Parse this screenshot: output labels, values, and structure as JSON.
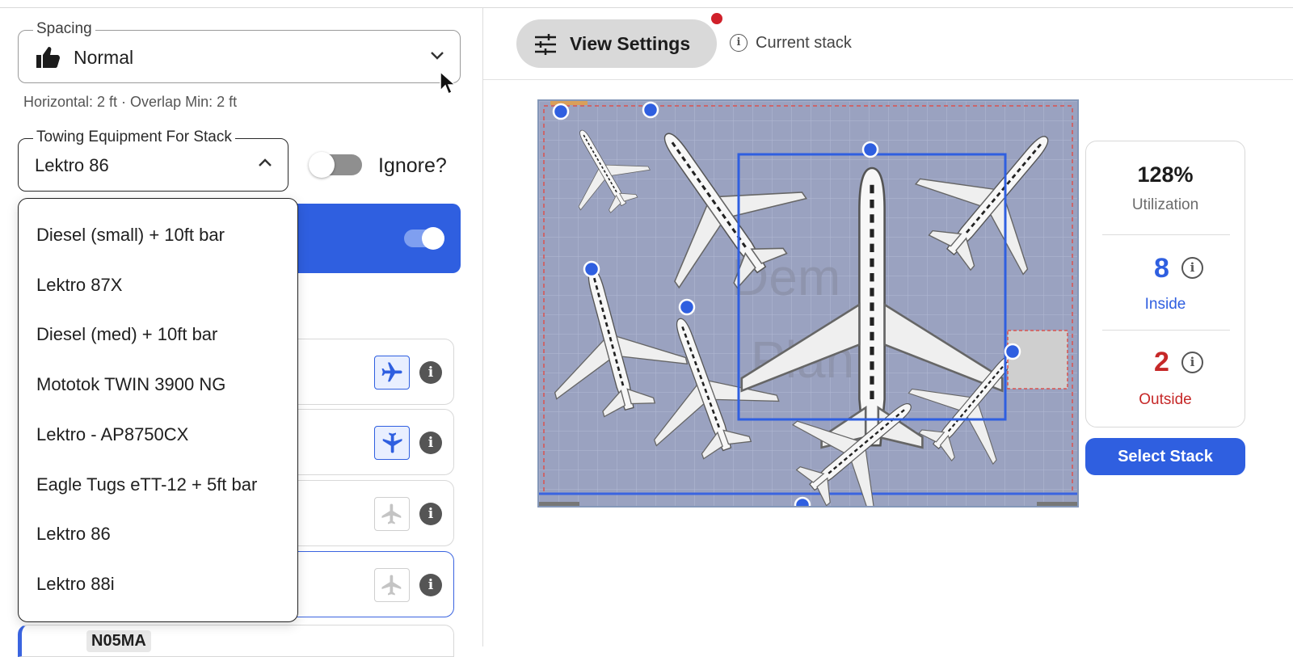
{
  "spacing": {
    "legend": "Spacing",
    "value": "Normal",
    "hint": "Horizontal: 2 ft · Overlap Min: 2 ft"
  },
  "towing": {
    "legend": "Towing Equipment For Stack",
    "value": "Lektro 86",
    "ignore_label": "Ignore?",
    "options": [
      "Diesel (small) + 10ft bar",
      "Lektro 87X",
      "Diesel (med) + 10ft bar",
      "Mototok TWIN 3900 NG",
      "Lektro - AP8750CX",
      "Eagle Tugs eTT-12 + 5ft bar",
      "Lektro 86",
      "Lektro 88i"
    ]
  },
  "aircraft_list": {
    "partial_tail": "N05MA"
  },
  "toolbar": {
    "view_settings": "View Settings",
    "current_stack": "Current stack"
  },
  "canvas": {
    "watermark_line1": "Dem",
    "watermark_line2": "Plan"
  },
  "stats": {
    "utilization_value": "128%",
    "utilization_label": "Utilization",
    "inside_count": "8",
    "inside_label": "Inside",
    "outside_count": "2",
    "outside_label": "Outside",
    "select_button": "Select Stack"
  },
  "colors": {
    "accent": "#2f5fe0",
    "inside": "#2f5fe0",
    "outside": "#c62828",
    "hangar_floor": "#9aa2c0"
  }
}
